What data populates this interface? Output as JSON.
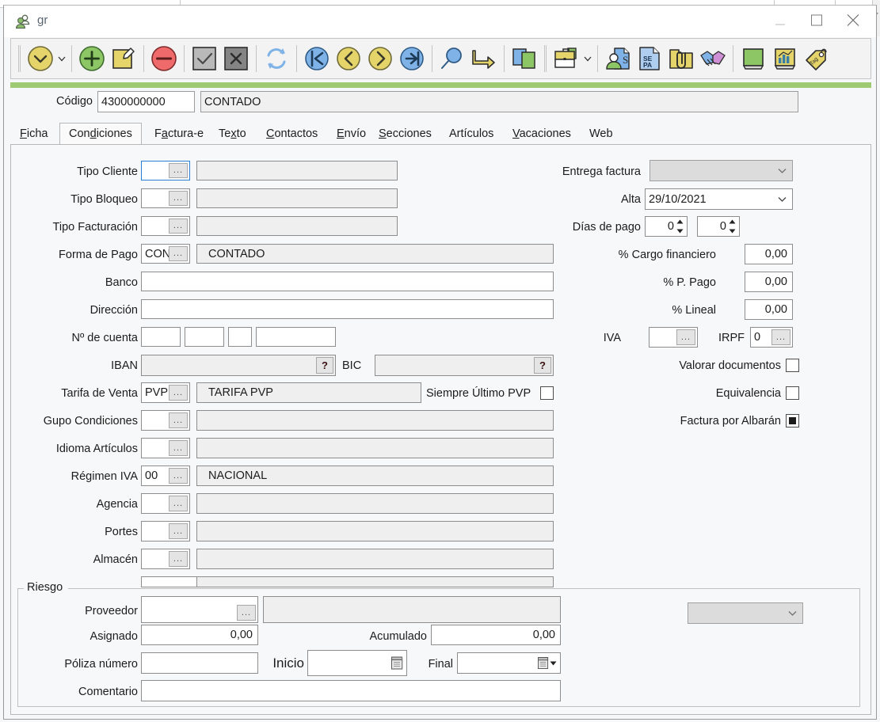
{
  "window": {
    "title": "gr",
    "title_icon": "users-group-icon",
    "minimize_label": "—",
    "maximize_label": "□",
    "close_label": "✕"
  },
  "toolbar": {
    "items": [
      {
        "name": "dropdown-menu-button",
        "icon": "chevron-down-circle-icon",
        "label": ""
      },
      {
        "name": "caret-button",
        "icon": "chevron-down-icon",
        "label": ""
      },
      {
        "name": "add-button",
        "icon": "plus-circle-icon",
        "label": ""
      },
      {
        "name": "edit-button",
        "icon": "pencil-note-icon",
        "label": ""
      },
      {
        "name": "delete-button",
        "icon": "minus-circle-icon",
        "label": ""
      },
      {
        "name": "accept-button",
        "icon": "check-square-icon",
        "label": ""
      },
      {
        "name": "cancel-button",
        "icon": "cross-square-icon",
        "label": ""
      },
      {
        "name": "refresh-button",
        "icon": "refresh-arrows-icon",
        "label": ""
      },
      {
        "name": "first-record-button",
        "icon": "go-first-icon",
        "label": ""
      },
      {
        "name": "previous-record-button",
        "icon": "go-previous-icon",
        "label": ""
      },
      {
        "name": "next-record-button",
        "icon": "go-next-icon",
        "label": ""
      },
      {
        "name": "last-record-button",
        "icon": "go-last-icon",
        "label": ""
      },
      {
        "name": "search-button",
        "icon": "magnifier-icon",
        "label": ""
      },
      {
        "name": "goto-button",
        "icon": "arrow-turn-right-icon",
        "label": ""
      },
      {
        "name": "copy-button",
        "icon": "copy-pages-icon",
        "label": ""
      },
      {
        "name": "briefcase-button",
        "icon": "briefcase-icon",
        "label": ""
      },
      {
        "name": "briefcase-caret-button",
        "icon": "chevron-down-icon",
        "label": ""
      },
      {
        "name": "contact-document-button",
        "icon": "person-document-icon",
        "label": ""
      },
      {
        "name": "sepa-button",
        "icon": "sepa-document-icon",
        "label": ""
      },
      {
        "name": "attachments-button",
        "icon": "folder-clip-icon",
        "label": ""
      },
      {
        "name": "agreements-button",
        "icon": "handshake-icon",
        "label": ""
      },
      {
        "name": "ledger-button",
        "icon": "green-book-icon",
        "label": ""
      },
      {
        "name": "statistics-button",
        "icon": "chart-book-icon",
        "label": ""
      },
      {
        "name": "tags-button",
        "icon": "price-tag-icon",
        "label": ""
      }
    ]
  },
  "header": {
    "codigo_label": "Código",
    "codigo_value": "4300000000",
    "name_value": "CONTADO"
  },
  "tabs": [
    {
      "label": "Ficha",
      "mnemonic": "F",
      "active": false
    },
    {
      "label": "Condiciones",
      "mnemonic": "d",
      "active": true
    },
    {
      "label": "Factura-e",
      "mnemonic": "a",
      "active": false
    },
    {
      "label": "Texto",
      "mnemonic": "x",
      "active": false
    },
    {
      "label": "Contactos",
      "mnemonic": "C",
      "active": false
    },
    {
      "label": "Envío",
      "mnemonic": "E",
      "active": false
    },
    {
      "label": "Secciones",
      "mnemonic": "S",
      "active": false
    },
    {
      "label": "Artículos",
      "mnemonic": "",
      "active": false
    },
    {
      "label": "Vacaciones",
      "mnemonic": "V",
      "active": false
    },
    {
      "label": "Web",
      "mnemonic": "",
      "active": false
    }
  ],
  "left_fields": [
    {
      "label": "Tipo Cliente",
      "code": "",
      "desc": "",
      "focused": true
    },
    {
      "label": "Tipo Bloqueo",
      "code": "",
      "desc": "",
      "focused": false
    },
    {
      "label": "Tipo Facturación",
      "code": "",
      "desc": "",
      "focused": false
    },
    {
      "label": "Forma de Pago",
      "code": "CON",
      "desc": "CONTADO",
      "focused": false
    }
  ],
  "bank": {
    "banco_label": "Banco",
    "banco_value": "",
    "direccion_label": "Dirección",
    "direccion_value": "",
    "cuenta_label": "Nº de cuenta",
    "cuenta_parts": [
      "",
      "",
      "",
      ""
    ],
    "iban_label": "IBAN",
    "iban_value": "",
    "iban_help": "?",
    "bic_label": "BIC",
    "bic_value": "",
    "bic_help": "?"
  },
  "tarifa": {
    "label": "Tarifa de Venta",
    "code": "PVP",
    "desc": "TARIFA PVP",
    "siempre_label": "Siempre Último PVP",
    "siempre_checked": false
  },
  "left_fields2": [
    {
      "label": "Gupo Condiciones",
      "code": "",
      "desc": ""
    },
    {
      "label": "Idioma Artículos",
      "code": "",
      "desc": ""
    },
    {
      "label": "Régimen IVA",
      "code": "00",
      "desc": "NACIONAL"
    },
    {
      "label": "Agencia",
      "code": "",
      "desc": ""
    },
    {
      "label": "Portes",
      "code": "",
      "desc": ""
    },
    {
      "label": "Almacén",
      "code": "",
      "desc": ""
    }
  ],
  "right_fields": {
    "entrega_label": "Entrega factura",
    "entrega_value": "",
    "alta_label": "Alta",
    "alta_value": "29/10/2021",
    "dias_label": "Días de pago",
    "dias_value_1": "0",
    "dias_value_2": "0",
    "cargo_label": "% Cargo financiero",
    "cargo_value": "0,00",
    "ppago_label": "% P. Pago",
    "ppago_value": "0,00",
    "lineal_label": "% Lineal",
    "lineal_value": "0,00",
    "iva_label": "IVA",
    "iva_value": "",
    "irpf_label": "IRPF",
    "irpf_value": "0",
    "valorar_label": "Valorar documentos",
    "valorar_checked": false,
    "equivalencia_label": "Equivalencia",
    "equivalencia_checked": false,
    "albaran_label": "Factura por Albarán",
    "albaran_checked": true
  },
  "riesgo": {
    "title": "Riesgo",
    "proveedor_label": "Proveedor",
    "proveedor_code": "",
    "proveedor_desc": "",
    "asignado_label": "Asignado",
    "asignado_value": "0,00",
    "acumulado_label": "Acumulado",
    "acumulado_value": "0,00",
    "poliza_label": "Póliza número",
    "poliza_value": "",
    "inicio_label": "Inicio",
    "inicio_value": "",
    "final_label": "Final",
    "final_value": "",
    "comentario_label": "Comentario",
    "comentario_value": "",
    "bottom_combo_value": ""
  },
  "colors": {
    "accent_green": "#9dca72",
    "focus_blue": "#2a7fd4",
    "panel_bg": "#f7f8f9",
    "toolbar_bg": "#f3f3f3",
    "yellow": "#e5d46a",
    "green": "#8cc665",
    "red": "#ef6a6a",
    "blue": "#7fb3e8"
  }
}
